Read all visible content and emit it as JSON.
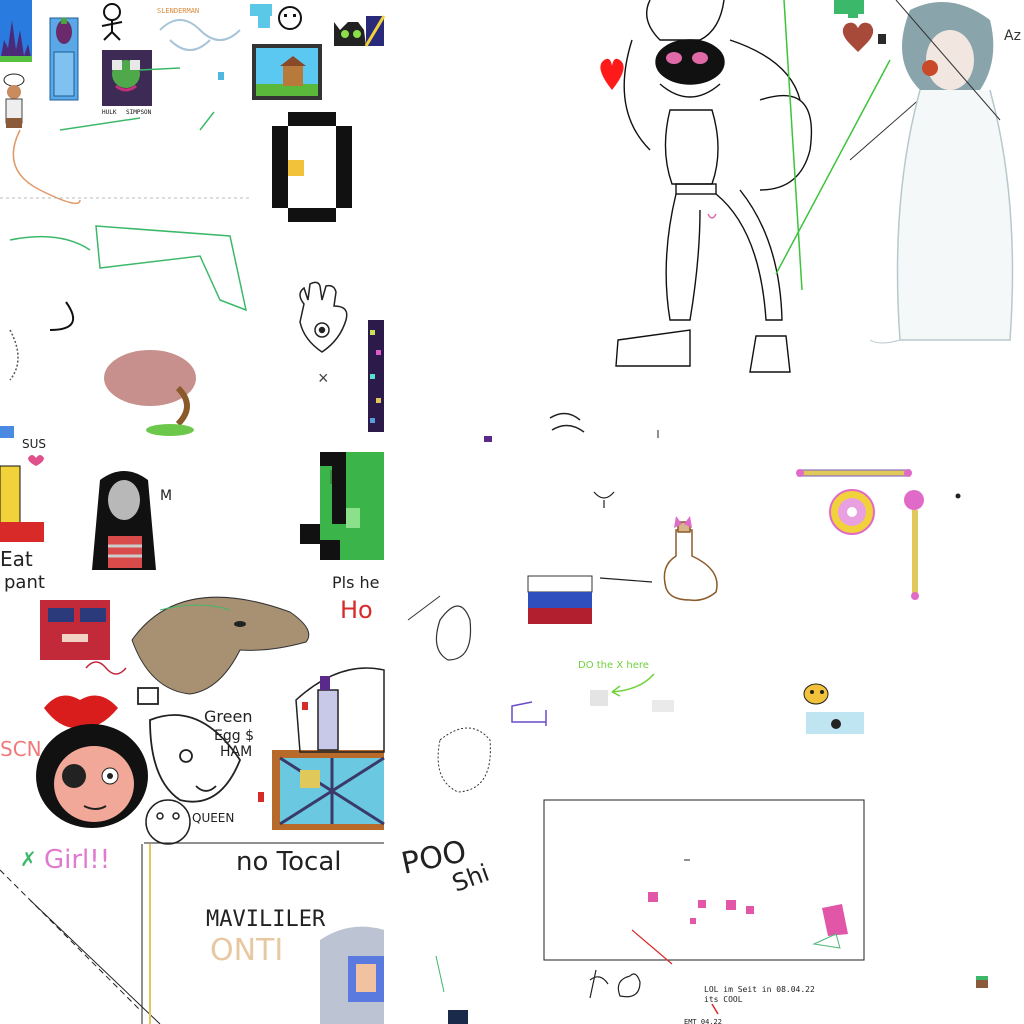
{
  "canvas": {
    "background": "#ffffff",
    "colors": {
      "russian_flag": [
        "#ffffff",
        "#2f4fbf",
        "#b21f2f"
      ],
      "heart": "#ff1a1a",
      "lips": "#d91c1c",
      "lizard": "#a89172",
      "creeper": "#3bb54a",
      "pink": "#e256a8",
      "green_line": "#3cc43c",
      "note_green": "#6fd23a",
      "orange_text": "#d98a3a",
      "red_text": "#d92a2a",
      "teal": "#4fb8c4"
    },
    "icons": [
      "heart-icon",
      "russian-flag-icon",
      "potion-bottle-icon",
      "magic-wand-icon",
      "compact-mirror-icon",
      "hamsa-hand-icon",
      "creeper-face-icon",
      "lips-icon",
      "bee-character-icon",
      "house-painting-icon",
      "mushroom-tree-icon"
    ]
  },
  "labels": {
    "slenderman": "SLENDERMAN",
    "hulk": "HULK",
    "simpson": "SIMPSON",
    "sus": "SUS",
    "eat": "Eat",
    "pant": "pant",
    "m": "M",
    "pls": "Pls he",
    "ho": "Ho",
    "green": "Green",
    "eggs": "Egg $",
    "ham": "HAM",
    "queen": "QUEEN",
    "girl": "Girl!!",
    "no_tocal": "no Tocal",
    "maviliier": "MAVILILER",
    "onti": "ONTI",
    "poo": "POO",
    "shi": "Shi",
    "do_the_x": "DO the X here",
    "lol": "LOL im Seit in 08.04.22",
    "cool": "its COOL",
    "az": "Az"
  }
}
